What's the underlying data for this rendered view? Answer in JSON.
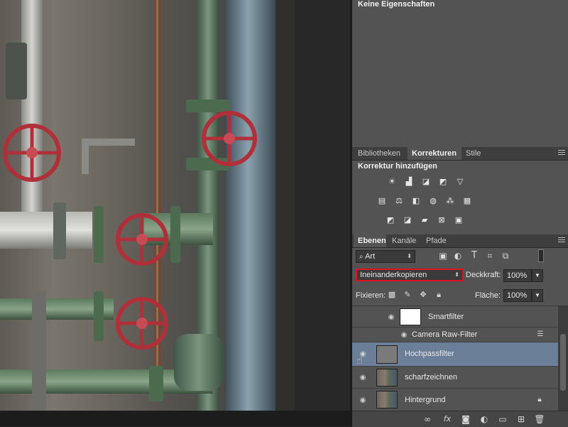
{
  "properties": {
    "title": "Keine Eigenschaften"
  },
  "adjustments_panel": {
    "tabs": [
      {
        "label": "Bibliotheken",
        "active": false
      },
      {
        "label": "Korrekturen",
        "active": true
      },
      {
        "label": "Stile",
        "active": false
      }
    ],
    "heading": "Korrektur hinzufügen",
    "icons": [
      "brightness-contrast-icon",
      "levels-icon",
      "curves-icon",
      "exposure-icon",
      "gradient-triangle-icon",
      "vibrance-icon",
      "color-balance-icon",
      "black-white-icon",
      "photo-filter-icon",
      "channel-mixer-icon",
      "color-lookup-icon",
      "invert-icon",
      "posterize-icon",
      "threshold-icon",
      "selective-color-icon",
      "gradient-map-icon"
    ]
  },
  "layers_panel": {
    "tabs": [
      {
        "label": "Ebenen",
        "active": true
      },
      {
        "label": "Kanäle",
        "active": false
      },
      {
        "label": "Pfade",
        "active": false
      }
    ],
    "filter_kind": "Art",
    "blend_mode": "Ineinanderkopieren",
    "opacity_label": "Deckkraft:",
    "opacity_value": "100%",
    "lock_label": "Fixieren:",
    "fill_label": "Fläche:",
    "fill_value": "100%",
    "layers": [
      {
        "name": "Smartfilter",
        "type": "smart-filter-mask"
      },
      {
        "name": "Camera Raw-Filter",
        "type": "filter"
      },
      {
        "name": "Hochpassfilter",
        "type": "layer",
        "selected": true
      },
      {
        "name": "scharfzeichnen",
        "type": "layer"
      },
      {
        "name": "Hintergrund",
        "type": "layer",
        "locked": true
      }
    ]
  },
  "colors": {
    "panel_bg": "#535353",
    "selected_layer": "#6b7f99",
    "highlight_box": "#e0141e",
    "valve_red": "#b0303a",
    "pipe_green": "#4f6e50",
    "pipe_blue": "#6b8494"
  }
}
